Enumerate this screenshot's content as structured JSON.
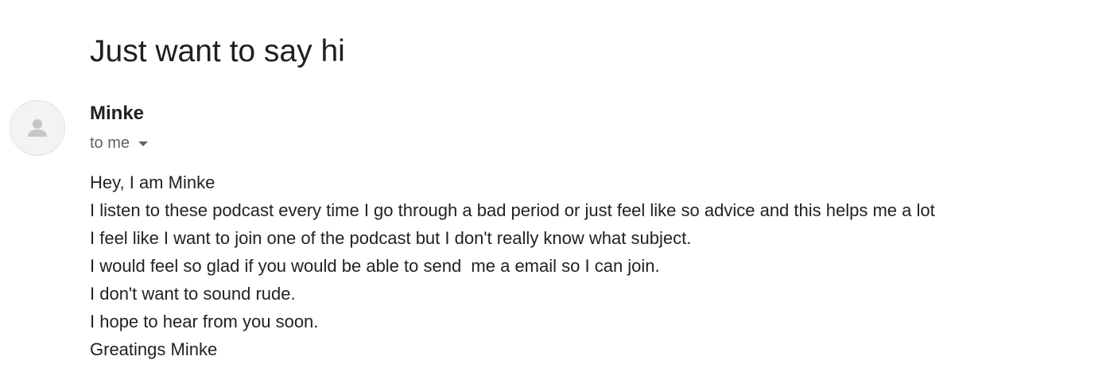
{
  "email": {
    "subject": "Just want to say hi",
    "sender": {
      "name": "Minke",
      "avatar_icon": "person-icon"
    },
    "recipient": {
      "label": "to me",
      "dropdown_icon": "chevron-down-icon"
    },
    "body_lines": [
      "Hey, I am Minke",
      "I listen to these podcast every time I go through a bad period or just feel like so advice and this helps me a lot",
      "I feel like I want to join one of the podcast but I don't really know what subject.",
      "I would feel so glad if you would be able to send  me a email so I can join.",
      "I don't want to sound rude.",
      "I hope to hear from you soon.",
      "Greatings Minke"
    ]
  },
  "colors": {
    "text_primary": "#1f1f1f",
    "text_secondary": "#5f6368",
    "avatar_bg": "#f1f3f4",
    "avatar_figure": "#c4c7c5"
  }
}
